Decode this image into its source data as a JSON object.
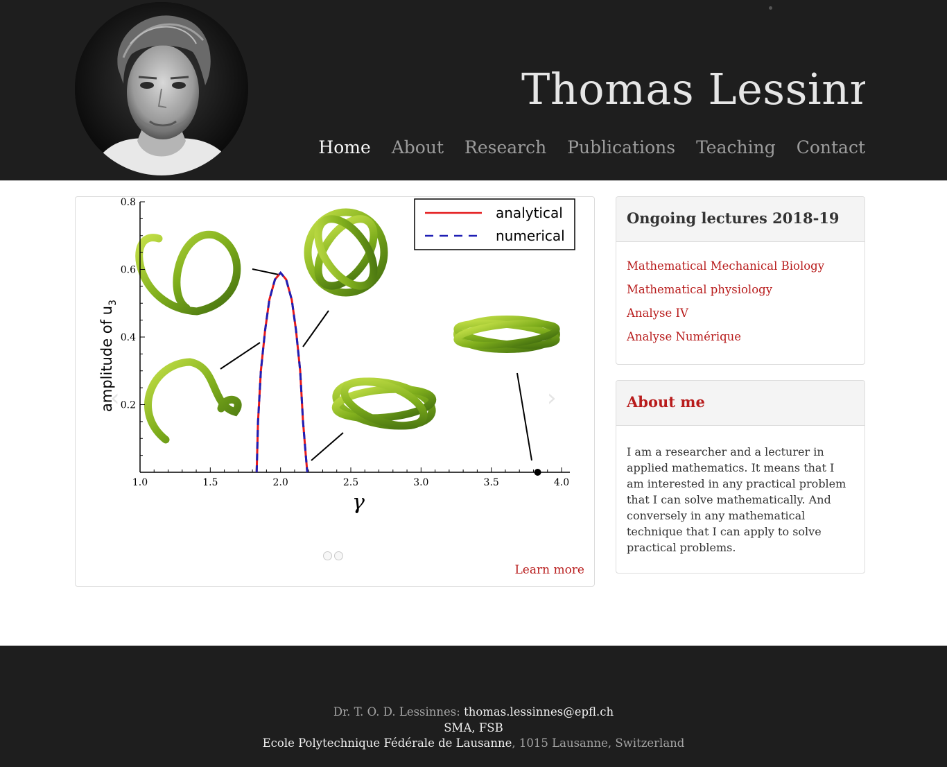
{
  "header": {
    "title": "Thomas Lessinnes",
    "avatar_alt": "portrait photo",
    "nav": [
      "Home",
      "About",
      "Research",
      "Publications",
      "Teaching",
      "Contact"
    ]
  },
  "carousel": {
    "learn_more": "Learn more",
    "prev_icon": "chevron-left-icon",
    "next_icon": "chevron-right-icon",
    "slide_count": 2
  },
  "chart_data": {
    "type": "line",
    "xlabel": "γ",
    "ylabel": "amplitude of",
    "ylabel_sub": "u",
    "ylabel_subscript": "3",
    "x_ticks": [
      "1.0",
      "1.5",
      "2.0",
      "2.5",
      "3.0",
      "3.5",
      "4.0"
    ],
    "y_ticks": [
      "0.8",
      "0.6",
      "0.4",
      "0.2"
    ],
    "xlim": [
      1.0,
      4.0
    ],
    "ylim": [
      0,
      0.8
    ],
    "legend": "top-right",
    "series": [
      {
        "name": "analytical",
        "color": "#e31a1c",
        "style": "solid",
        "x": [
          1.83,
          1.84,
          1.86,
          1.89,
          1.92,
          1.96,
          2.0,
          2.04,
          2.08,
          2.11,
          2.14,
          2.16,
          2.18,
          2.19
        ],
        "y": [
          0.0,
          0.15,
          0.3,
          0.42,
          0.51,
          0.57,
          0.59,
          0.57,
          0.51,
          0.42,
          0.3,
          0.15,
          0.05,
          0.0
        ]
      },
      {
        "name": "numerical",
        "color": "#1f1fb4",
        "style": "dashed",
        "x": [
          1.83,
          1.84,
          1.86,
          1.89,
          1.92,
          1.96,
          2.0,
          2.04,
          2.08,
          2.11,
          2.14,
          2.16,
          2.18,
          2.19
        ],
        "y": [
          0.0,
          0.15,
          0.3,
          0.42,
          0.51,
          0.57,
          0.59,
          0.57,
          0.51,
          0.42,
          0.3,
          0.15,
          0.05,
          0.0
        ]
      }
    ],
    "points": [
      {
        "x": 3.83,
        "y": 0.0
      }
    ]
  },
  "sidebar": {
    "lectures_title": "Ongoing lectures 2018-19",
    "lectures": [
      "Mathematical Mechanical Biology",
      "Mathematical physiology",
      "Analyse IV",
      "Analyse Numérique"
    ],
    "about_title": "About me",
    "about_text": "I am a researcher and a lecturer in applied mathematics. It means that I am interested in any practical problem that I can solve mathematically. And conversely in any mathematical technique that I can apply to solve practical problems."
  },
  "footer": {
    "name_prefix": "Dr. T. O. D. Lessinnes: ",
    "email": "thomas.lessinnes@epfl.ch",
    "line2": "SMA, FSB",
    "line3_a": "Ecole Polytechnique Fédérale de Lausanne",
    "line3_b": ", 1015 Lausanne, Switzerland"
  }
}
